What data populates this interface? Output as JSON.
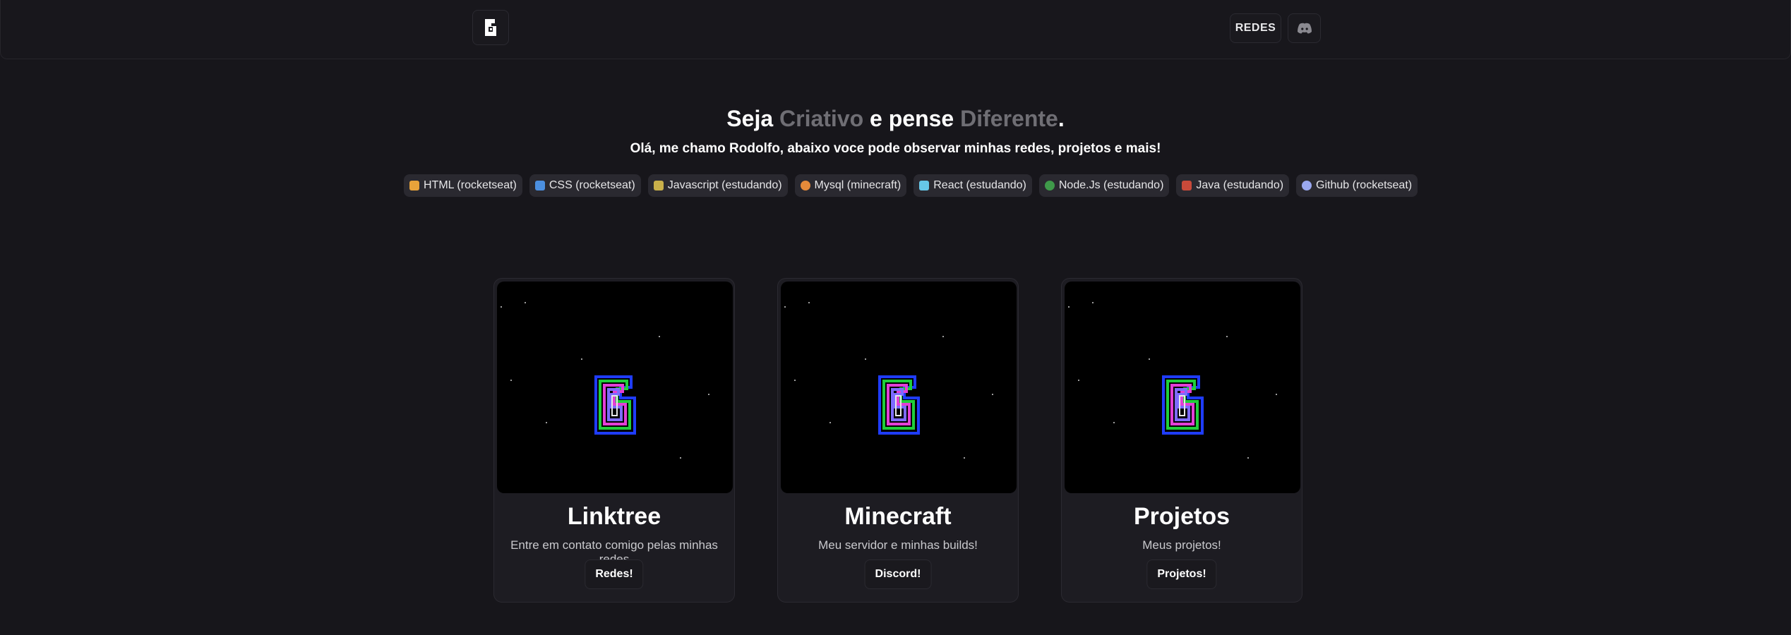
{
  "header": {
    "logo_icon": "brand-logo-icon",
    "redes_label": "REDES",
    "discord_icon": "discord-icon"
  },
  "hero": {
    "title_part1": "Seja ",
    "title_word1": "Criativo",
    "title_part2": " e pense ",
    "title_word2": "Diferente",
    "title_part3": ".",
    "subtitle": "Olá, me chamo Rodolfo, abaixo voce pode observar minhas redes, projetos e mais!"
  },
  "techs": [
    {
      "label": "HTML (rocketseat)",
      "icon": "html-icon",
      "color": "#e8a33a"
    },
    {
      "label": "CSS (rocketseat)",
      "icon": "css-icon",
      "color": "#4b8fe0"
    },
    {
      "label": "Javascript (estudando)",
      "icon": "javascript-icon",
      "color": "#c9b04a"
    },
    {
      "label": "Mysql (minecraft)",
      "icon": "mysql-icon",
      "color": "#e58a3a"
    },
    {
      "label": "React (estudando)",
      "icon": "react-icon",
      "color": "#66c7e8"
    },
    {
      "label": "Node.Js (estudando)",
      "icon": "nodejs-icon",
      "color": "#3f9a4a"
    },
    {
      "label": "Java (estudando)",
      "icon": "java-icon",
      "color": "#c94a3a"
    },
    {
      "label": "Github (rocketseat)",
      "icon": "github-icon",
      "color": "#9aa8f0"
    }
  ],
  "cards": [
    {
      "title": "Linktree",
      "description": "Entre em contato comigo pelas minhas redes",
      "button": "Redes!",
      "image_icon": "neon-logo-animation"
    },
    {
      "title": "Minecraft",
      "description": "Meu servidor e minhas builds!",
      "button": "Discord!",
      "image_icon": "neon-logo-animation"
    },
    {
      "title": "Projetos",
      "description": "Meus projetos!",
      "button": "Projetos!",
      "image_icon": "neon-logo-animation"
    }
  ]
}
